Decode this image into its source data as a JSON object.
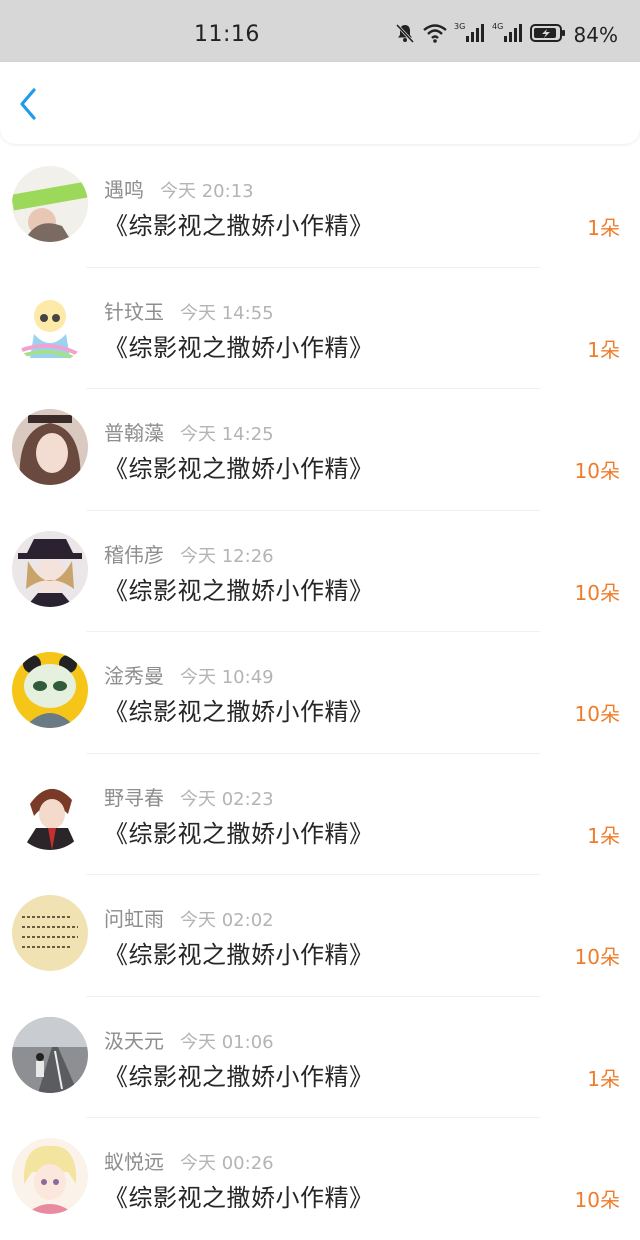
{
  "status": {
    "time": "11:16",
    "battery": "84%",
    "net1": "3G",
    "net2": "4G"
  },
  "colors": {
    "accent": "#1e9bea",
    "amount": "#f07c2a",
    "statusBar": "#d7d7d7"
  },
  "rows": [
    {
      "name": "遇鸣",
      "time": "今天 20:13",
      "book": "《综影视之撒娇小作精》",
      "amount": "1朵",
      "avatar": "avatar-green-sign"
    },
    {
      "name": "针玟玉",
      "time": "今天 14:55",
      "book": "《综影视之撒娇小作精》",
      "amount": "1朵",
      "avatar": "avatar-cartoon-girl"
    },
    {
      "name": "普翰藻",
      "time": "今天 14:25",
      "book": "《综影视之撒娇小作精》",
      "amount": "10朵",
      "avatar": "avatar-girl-photo"
    },
    {
      "name": "稽伟彦",
      "time": "今天 12:26",
      "book": "《综影视之撒娇小作精》",
      "amount": "10朵",
      "avatar": "avatar-anime-hat"
    },
    {
      "name": "淦秀曼",
      "time": "今天 10:49",
      "book": "《综影视之撒娇小作精》",
      "amount": "10朵",
      "avatar": "avatar-panda"
    },
    {
      "name": "野寻春",
      "time": "今天 02:23",
      "book": "《综影视之撒娇小作精》",
      "amount": "1朵",
      "avatar": "avatar-anime-boy"
    },
    {
      "name": "问虹雨",
      "time": "今天 02:02",
      "book": "《综影视之撒娇小作精》",
      "amount": "10朵",
      "avatar": "avatar-text-note"
    },
    {
      "name": "汲天元",
      "time": "今天 01:06",
      "book": "《综影视之撒娇小作精》",
      "amount": "1朵",
      "avatar": "avatar-road-photo"
    },
    {
      "name": "蚁悦远",
      "time": "今天 00:26",
      "book": "《综影视之撒娇小作精》",
      "amount": "10朵",
      "avatar": "avatar-anime-blonde"
    }
  ]
}
